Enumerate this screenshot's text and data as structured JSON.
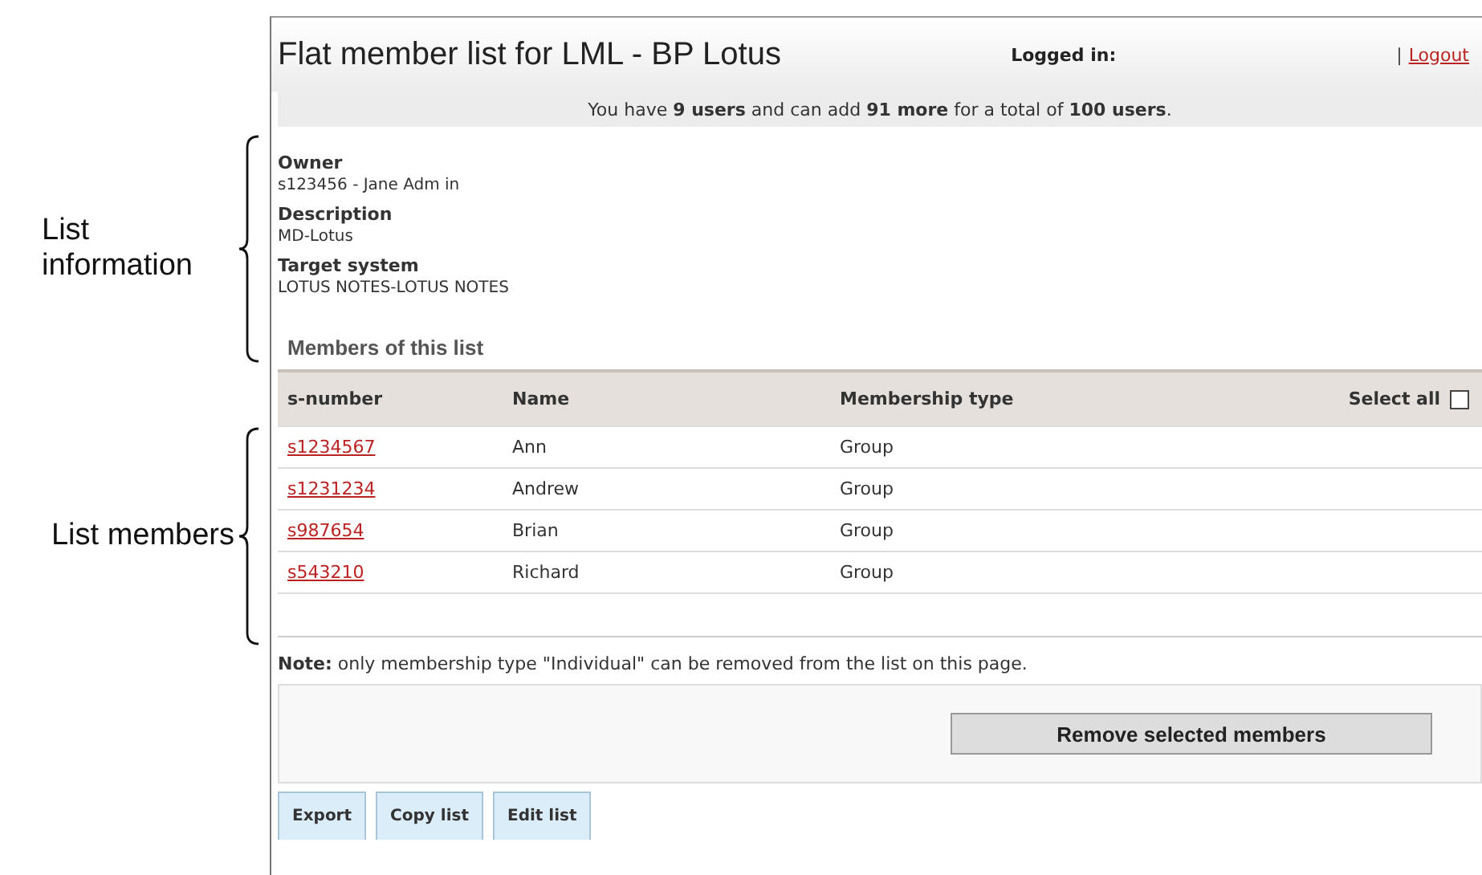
{
  "annotations": [
    {
      "label": "List information"
    },
    {
      "label": "List members"
    }
  ],
  "header": {
    "title": "Flat member list for LML - BP Lotus",
    "logged_in": "Logged in:",
    "separator": "|",
    "logout": "Logout"
  },
  "summary": "You have **9 users** and can add **91 more** for a total of **100 users**.",
  "info": [
    {
      "label": "Owner",
      "value": "s123456 - Jane Adm in"
    },
    {
      "label": "Description",
      "value": "MD-Lotus"
    },
    {
      "label": "Target system",
      "value": "LOTUS NOTES-LOTUS NOTES"
    }
  ],
  "members_heading": "Members of this list",
  "table": {
    "columns": [
      "s-number",
      "Name",
      "Membership type"
    ],
    "select_all": {
      "label": "Select all",
      "checked": false
    },
    "rows": [
      {
        "s_number": "s1234567",
        "name": "Ann",
        "type": "Group"
      },
      {
        "s_number": "s1231234",
        "name": "Andrew",
        "type": "Group"
      },
      {
        "s_number": "s987654",
        "name": "Brian",
        "type": "Group"
      },
      {
        "s_number": "s543210",
        "name": "Richard",
        "type": "Group"
      }
    ]
  },
  "note": "**Note:** only membership type \"Individual\" can be removed from the list on this page.",
  "remove_button": "Remove selected members",
  "buttons": [
    "Export",
    "Copy list",
    "Edit list"
  ]
}
